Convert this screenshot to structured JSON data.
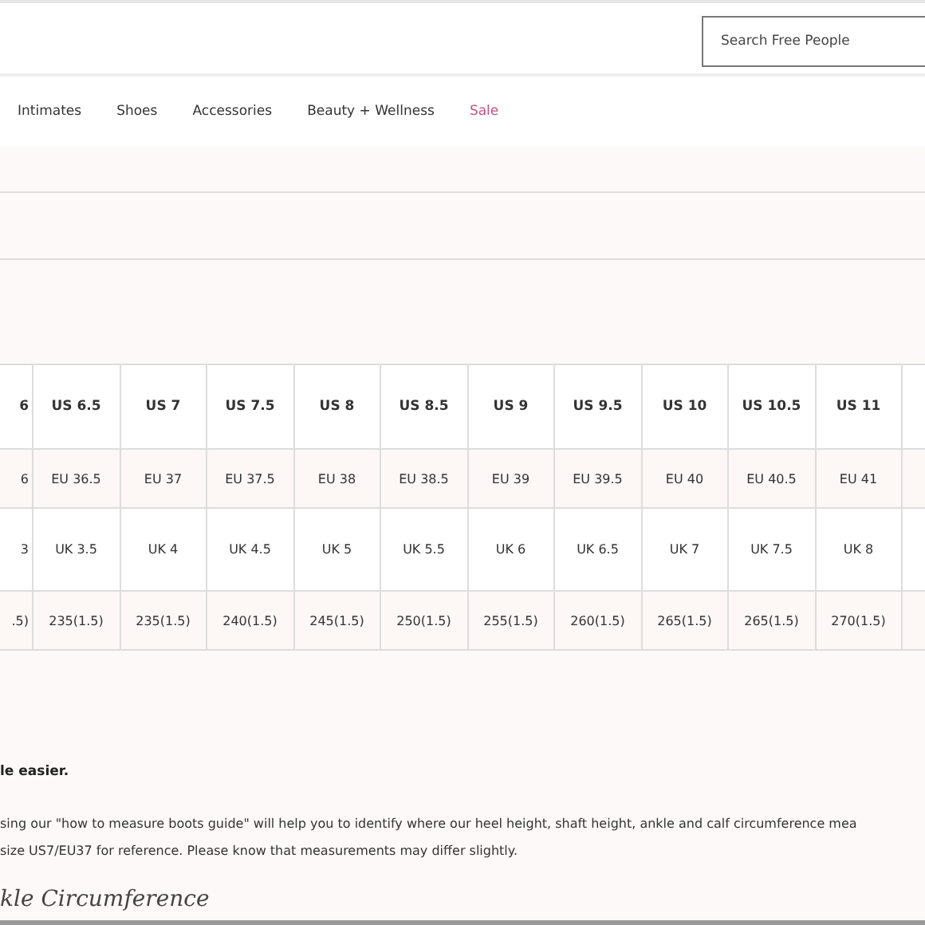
{
  "search": {
    "placeholder": "Search Free People"
  },
  "nav": [
    {
      "label": "Intimates",
      "kind": "normal"
    },
    {
      "label": "Shoes",
      "kind": "normal"
    },
    {
      "label": "Accessories",
      "kind": "normal"
    },
    {
      "label": "Beauty + Wellness",
      "kind": "normal"
    },
    {
      "label": "Sale",
      "kind": "sale"
    }
  ],
  "table": {
    "rows": [
      [
        "6",
        "US 6.5",
        "US 7",
        "US 7.5",
        "US 8",
        "US 8.5",
        "US 9",
        "US 9.5",
        "US 10",
        "US 10.5",
        "US 11"
      ],
      [
        "6",
        "EU 36.5",
        "EU 37",
        "EU 37.5",
        "EU 38",
        "EU 38.5",
        "EU 39",
        "EU 39.5",
        "EU 40",
        "EU 40.5",
        "EU 41"
      ],
      [
        "3",
        "UK 3.5",
        "UK 4",
        "UK 4.5",
        "UK 5",
        "UK 5.5",
        "UK 6",
        "UK 6.5",
        "UK 7",
        "UK 7.5",
        "UK 8"
      ],
      [
        ".5)",
        "235(1.5)",
        "235(1.5)",
        "240(1.5)",
        "245(1.5)",
        "250(1.5)",
        "255(1.5)",
        "260(1.5)",
        "265(1.5)",
        "265(1.5)",
        "270(1.5)"
      ]
    ]
  },
  "note": {
    "heading": "le easier.",
    "lines": [
      "sing our \"how to measure boots guide\" will help you to identify where our heel height, shaft height, ankle and calf circumference mea",
      "size US7/EU37 for reference. Please know that measurements may differ slightly."
    ],
    "handwriting": "kle Circumference"
  }
}
